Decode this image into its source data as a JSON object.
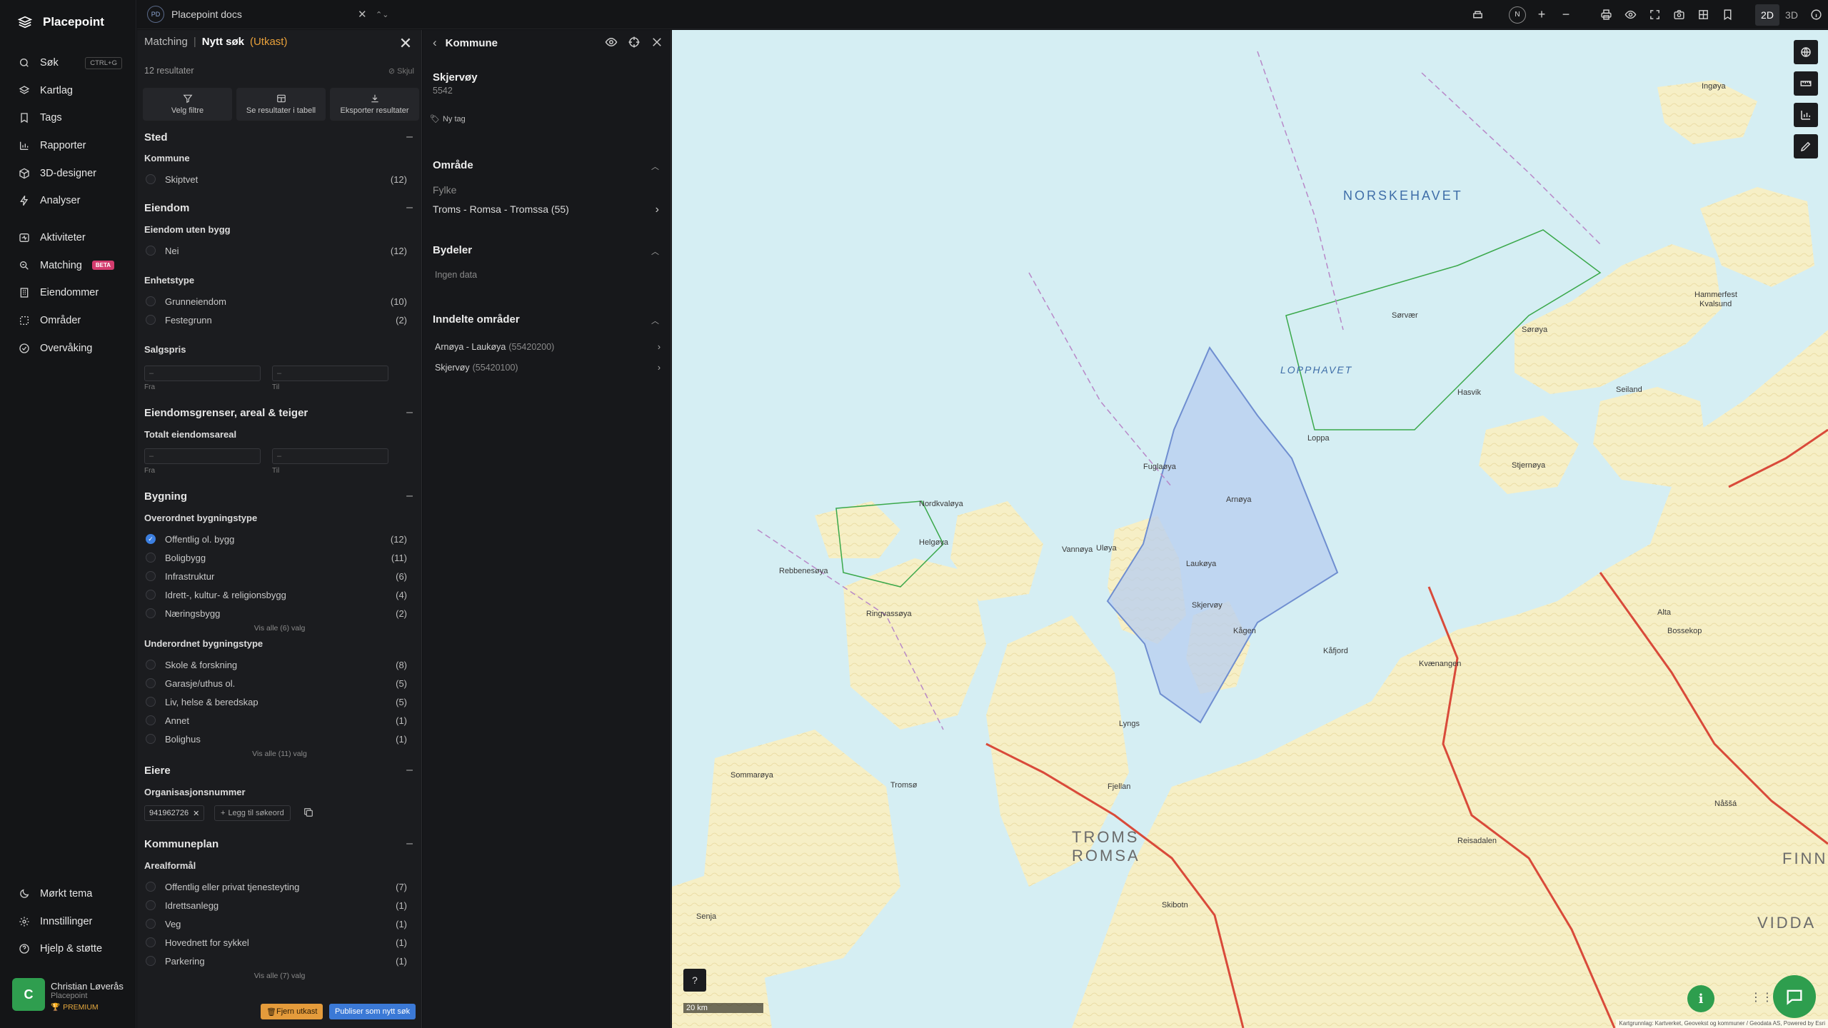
{
  "app": {
    "name": "Placepoint"
  },
  "nav": {
    "items": [
      {
        "label": "Søk",
        "icon": "search-icon",
        "kbd": "CTRL+G"
      },
      {
        "label": "Kartlag",
        "icon": "layers-icon"
      },
      {
        "label": "Tags",
        "icon": "bookmark-icon"
      },
      {
        "label": "Rapporter",
        "icon": "chart-icon"
      },
      {
        "label": "3D-designer",
        "icon": "cube-icon"
      },
      {
        "label": "Analyser",
        "icon": "bolt-icon"
      },
      {
        "label": "Aktiviteter",
        "icon": "activity-icon"
      },
      {
        "label": "Matching",
        "icon": "match-icon",
        "badge": "BETA"
      },
      {
        "label": "Eiendommer",
        "icon": "building-icon"
      },
      {
        "label": "Områder",
        "icon": "area-icon"
      },
      {
        "label": "Overvåking",
        "icon": "monitor-icon"
      }
    ],
    "bottom": [
      {
        "label": "Mørkt tema",
        "icon": "moon-icon"
      },
      {
        "label": "Innstillinger",
        "icon": "gear-icon"
      },
      {
        "label": "Hjelp & støtte",
        "icon": "help-icon"
      }
    ],
    "user": {
      "initial": "C",
      "name": "Christian Løverås",
      "org": "Placepoint",
      "plan": "PREMIUM"
    }
  },
  "topbar": {
    "doc_initials": "PD",
    "doc_title": "Placepoint docs",
    "compass": "N",
    "mode_2d": "2D",
    "mode_3d": "3D"
  },
  "search": {
    "crumb": "Matching",
    "title": "Nytt søk",
    "status": "(Utkast)",
    "results": "12 resultater",
    "hide": "Skjul",
    "actions": [
      "Velg filtre",
      "Se resultater i tabell",
      "Eksporter resultater"
    ],
    "sections": {
      "sted": "Sted",
      "kommune": "Kommune",
      "kommune_items": [
        {
          "label": "Skiptvet",
          "count": "(12)"
        }
      ],
      "eiendom": "Eiendom",
      "uten_bygg": "Eiendom uten bygg",
      "uten_bygg_items": [
        {
          "label": "Nei",
          "count": "(12)"
        }
      ],
      "enhetstype": "Enhetstype",
      "enhetstype_items": [
        {
          "label": "Grunneiendom",
          "count": "(10)"
        },
        {
          "label": "Festegrunn",
          "count": "(2)"
        }
      ],
      "salgspris": "Salgspris",
      "from": "Fra",
      "to": "Til",
      "dash": "–",
      "grenser": "Eiendomsgrenser, areal & teiger",
      "totalt": "Totalt eiendomsareal",
      "bygning": "Bygning",
      "overordnet": "Overordnet bygningstype",
      "overordnet_items": [
        {
          "label": "Offentlig ol. bygg",
          "count": "(12)"
        },
        {
          "label": "Boligbygg",
          "count": "(11)"
        },
        {
          "label": "Infrastruktur",
          "count": "(6)"
        },
        {
          "label": "Idrett-, kultur- & religionsbygg",
          "count": "(4)"
        },
        {
          "label": "Næringsbygg",
          "count": "(2)"
        }
      ],
      "overordnet_more": "Vis alle (6) valg",
      "underordnet": "Underordnet bygningstype",
      "underordnet_items": [
        {
          "label": "Skole & forskning",
          "count": "(8)"
        },
        {
          "label": "Garasje/uthus ol.",
          "count": "(5)"
        },
        {
          "label": "Liv, helse & beredskap",
          "count": "(5)"
        },
        {
          "label": "Annet",
          "count": "(1)"
        },
        {
          "label": "Bolighus",
          "count": "(1)"
        }
      ],
      "underordnet_more": "Vis alle (11) valg",
      "eiere": "Eiere",
      "orgnr": "Organisasjonsnummer",
      "orgnr_tag": "941962726",
      "add_keyword": "Legg til søkeord",
      "kommuneplan": "Kommuneplan",
      "arealformal": "Arealformål",
      "arealformal_items": [
        {
          "label": "Offentlig eller privat tjenesteyting",
          "count": "(7)"
        },
        {
          "label": "Idrettsanlegg",
          "count": "(1)"
        },
        {
          "label": "Veg",
          "count": "(1)"
        },
        {
          "label": "Hovednett for sykkel",
          "count": "(1)"
        },
        {
          "label": "Parkering",
          "count": "(1)"
        }
      ],
      "arealformal_more": "Vis alle (7) valg"
    },
    "btn_remove": "Fjern utkast",
    "btn_publish": "Publiser som nytt søk"
  },
  "detail": {
    "header": "Kommune",
    "name": "Skjervøy",
    "number": "5542",
    "new_tag": "Ny tag",
    "omrade": "Område",
    "fylke_label": "Fylke",
    "fylke_value": "Troms - Romsa - Tromssa (55)",
    "bydeler": "Bydeler",
    "no_data": "Ingen data",
    "inndelte": "Inndelte områder",
    "areas": [
      {
        "name": "Arnøya - Laukøya",
        "code": "(55420200)"
      },
      {
        "name": "Skjervøy",
        "code": "(55420100)"
      }
    ]
  },
  "map": {
    "labels": {
      "norskehavet": "NORSKEHAVET",
      "lopphavet": "LOPPHAVET",
      "troms": "TROMS",
      "romsa": "ROMSA",
      "finnmark": "FINNM",
      "vidda": "VIDDA",
      "towns": [
        "Hammerfest",
        "Kvalsund",
        "Alta",
        "Bossekop",
        "Skjervøy",
        "Tromsø",
        "Sørøya",
        "Seiland",
        "Loppa",
        "Arnøya",
        "Kågen",
        "Lyngs",
        "Fjellan",
        "Hasvik",
        "Kvænangen",
        "Nordkvaløya",
        "Ringvassøya",
        "Vannøya",
        "Sommarøya",
        "Senja",
        "Reisadalen",
        "Nåššá",
        "Fuglaøya",
        "Rebbenesøya",
        "Helgøya",
        "Stjernøya",
        "Kåfjord",
        "Skibotn",
        "Sørvær",
        "Ingøya",
        "Laukøya",
        "Uløya"
      ]
    },
    "scale": "20 km",
    "attribution": "Kartgrunnlag: Kartverket, Geovekst og kommuner / Geodata AS, Powered by Esri"
  },
  "colors": {
    "accent": "#3b79d6",
    "warning": "#e49b3b",
    "brand_green": "#2e9e4e",
    "beta": "#d33c6e",
    "selection_fill": "#b7cdf0"
  }
}
